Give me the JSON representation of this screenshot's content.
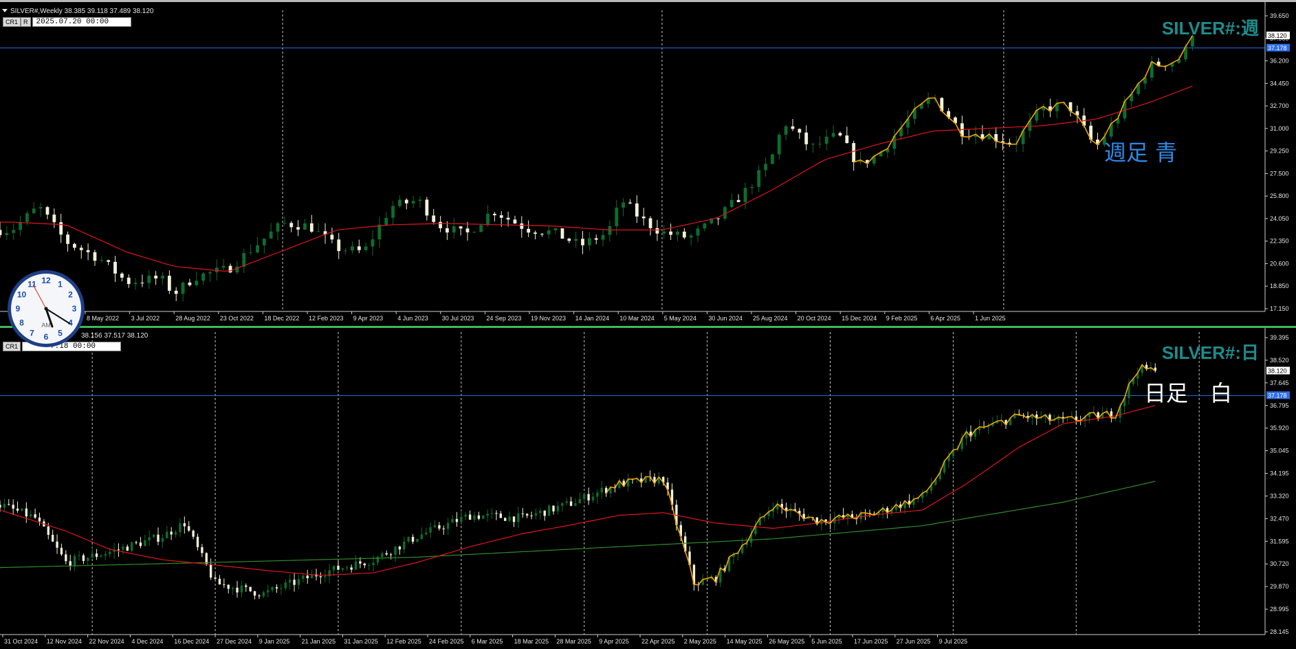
{
  "colors": {
    "background": "#000000",
    "grid": "#c8c8c8",
    "bull": "#0b6e2e",
    "bear": "#f2f2d8",
    "ma_red": "#e0161a",
    "ma_green": "#2f8c2a",
    "zigzag": "#f0a400",
    "hline": "#2e6fe6",
    "title": "#1d8c8c",
    "note_weekly": "#2f8ae6",
    "note_daily": "#ffffff"
  },
  "weekly": {
    "header": "SILVER#,Weekly  38.385 39.118 37.489 38.120",
    "btn1": "CR1",
    "btn2": "R",
    "datetime": "2025.07.20 00:00",
    "symbol_title": "SILVER#:週",
    "note": "週足 青",
    "price_labels": [
      "39.650",
      "37.900",
      "36.200",
      "34.450",
      "32.700",
      "31.000",
      "29.250",
      "27.500",
      "25.800",
      "24.050",
      "22.350",
      "20.600",
      "18.850",
      "17.150"
    ],
    "current_price": "38.120",
    "hline_price": "37.178",
    "date_labels": [
      "8 May 2022",
      "3 Jul 2022",
      "28 Aug 2022",
      "23 Oct 2022",
      "18 Dec 2022",
      "12 Feb 2023",
      "9 Apr 2023",
      "4 Jun 2023",
      "30 Jul 2023",
      "24 Sep 2023",
      "19 Nov 2023",
      "14 Jan 2024",
      "10 Mar 2024",
      "5 May 2024",
      "30 Jun 2024",
      "25 Aug 2024",
      "20 Oct 2024",
      "15 Dec 2024",
      "9 Feb 2025",
      "6 Apr 2025",
      "1 Jun 2025"
    ]
  },
  "daily": {
    "header": "38.156 37.517 38.120",
    "btn1": "CR1",
    "datetime": "7.18 00:00",
    "symbol_title": "SILVER#:日",
    "note": "日足　白",
    "price_labels": [
      "39.395",
      "38.520",
      "37.645",
      "36.795",
      "35.920",
      "35.045",
      "34.195",
      "33.320",
      "32.470",
      "31.595",
      "30.720",
      "29.870",
      "28.995",
      "28.145"
    ],
    "current_price": "38.120",
    "hline_price": "37.178",
    "date_labels": [
      "31 Oct 2024",
      "12 Nov 2024",
      "22 Nov 2024",
      "4 Dec 2024",
      "16 Dec 2024",
      "27 Dec 2024",
      "9 Jan 2025",
      "21 Jan 2025",
      "31 Jan 2025",
      "12 Feb 2025",
      "24 Feb 2025",
      "6 Mar 2025",
      "18 Mar 2025",
      "28 Mar 2025",
      "9 Apr 2025",
      "22 Apr 2025",
      "2 May 2025",
      "14 May 2025",
      "26 May 2025",
      "5 Jun 2025",
      "17 Jun 2025",
      "27 Jun 2025",
      "9 Jul 2025"
    ]
  },
  "clock": {
    "numbers": [
      "12",
      "1",
      "2",
      "3",
      "4",
      "5",
      "6",
      "7",
      "8",
      "9",
      "10",
      "11"
    ],
    "ampm": "AM"
  },
  "chart_data": [
    {
      "type": "candlestick",
      "title": "SILVER#:週",
      "timeframe": "Weekly",
      "ylim": [
        17.15,
        39.65
      ],
      "x_start": "2022-03",
      "x_end": "2025-07-20",
      "ohlc_last": {
        "open": 38.385,
        "high": 39.118,
        "low": 37.489,
        "close": 38.12
      },
      "horizontal_line": 37.178,
      "close_path": [
        [
          "2022-03-13",
          23.2
        ],
        [
          "2022-04-10",
          25.0
        ],
        [
          "2022-05-08",
          22.3
        ],
        [
          "2022-06-12",
          21.0
        ],
        [
          "2022-07-10",
          19.2
        ],
        [
          "2022-08-14",
          19.5
        ],
        [
          "2022-08-28",
          18.3
        ],
        [
          "2022-09-18",
          19.6
        ],
        [
          "2022-10-23",
          20.2
        ],
        [
          "2022-11-20",
          22.0
        ],
        [
          "2022-12-18",
          23.7
        ],
        [
          "2023-01-15",
          23.5
        ],
        [
          "2023-02-12",
          21.8
        ],
        [
          "2023-03-12",
          21.5
        ],
        [
          "2023-04-09",
          25.0
        ],
        [
          "2023-05-07",
          25.5
        ],
        [
          "2023-05-28",
          23.6
        ],
        [
          "2023-06-25",
          22.8
        ],
        [
          "2023-07-23",
          24.7
        ],
        [
          "2023-08-27",
          23.3
        ],
        [
          "2023-09-24",
          23.0
        ],
        [
          "2023-10-22",
          22.0
        ],
        [
          "2023-11-19",
          23.0
        ],
        [
          "2023-12-03",
          25.5
        ],
        [
          "2023-12-24",
          24.0
        ],
        [
          "2024-01-14",
          23.0
        ],
        [
          "2024-02-11",
          22.6
        ],
        [
          "2024-03-10",
          24.0
        ],
        [
          "2024-04-07",
          26.0
        ],
        [
          "2024-05-05",
          28.5
        ],
        [
          "2024-05-19",
          31.5
        ],
        [
          "2024-06-16",
          29.5
        ],
        [
          "2024-07-14",
          30.5
        ],
        [
          "2024-08-04",
          28.2
        ],
        [
          "2024-08-25",
          29.0
        ],
        [
          "2024-09-22",
          31.5
        ],
        [
          "2024-10-20",
          33.5
        ],
        [
          "2024-11-17",
          30.8
        ],
        [
          "2024-12-15",
          30.5
        ],
        [
          "2025-01-12",
          29.8
        ],
        [
          "2025-02-09",
          32.5
        ],
        [
          "2025-03-09",
          32.8
        ],
        [
          "2025-04-06",
          29.5
        ],
        [
          "2025-05-04",
          32.5
        ],
        [
          "2025-06-01",
          35.8
        ],
        [
          "2025-06-29",
          36.2
        ],
        [
          "2025-07-20",
          38.12
        ]
      ],
      "ma_red": [
        [
          "2022-03-13",
          23.8
        ],
        [
          "2022-05-08",
          23.6
        ],
        [
          "2022-07-10",
          21.5
        ],
        [
          "2022-08-28",
          20.4
        ],
        [
          "2022-10-23",
          20.0
        ],
        [
          "2022-12-18",
          21.6
        ],
        [
          "2023-02-12",
          23.2
        ],
        [
          "2023-04-09",
          23.6
        ],
        [
          "2023-06-04",
          23.7
        ],
        [
          "2023-07-30",
          23.6
        ],
        [
          "2023-09-24",
          23.5
        ],
        [
          "2023-11-19",
          23.2
        ],
        [
          "2024-01-14",
          23.2
        ],
        [
          "2024-03-10",
          24.1
        ],
        [
          "2024-05-05",
          26.2
        ],
        [
          "2024-06-30",
          28.6
        ],
        [
          "2024-08-25",
          29.8
        ],
        [
          "2024-10-20",
          30.8
        ],
        [
          "2024-12-15",
          31.0
        ],
        [
          "2025-02-09",
          31.2
        ],
        [
          "2025-04-06",
          31.7
        ],
        [
          "2025-06-01",
          33.0
        ],
        [
          "2025-07-20",
          34.4
        ]
      ]
    },
    {
      "type": "candlestick",
      "title": "SILVER#:日",
      "timeframe": "Daily",
      "ylim": [
        28.145,
        39.395
      ],
      "x_start": "2024-10-28",
      "x_end": "2025-07-18",
      "ohlc_last": {
        "high": 38.156,
        "low": 37.517,
        "close": 38.12
      },
      "horizontal_line": 37.178,
      "close_path": [
        [
          "2024-10-28",
          33.0
        ],
        [
          "2024-11-05",
          32.5
        ],
        [
          "2024-11-12",
          30.8
        ],
        [
          "2024-11-22",
          31.2
        ],
        [
          "2024-12-04",
          31.8
        ],
        [
          "2024-12-09",
          32.3
        ],
        [
          "2024-12-16",
          30.0
        ],
        [
          "2024-12-27",
          29.6
        ],
        [
          "2025-01-09",
          30.4
        ],
        [
          "2025-01-21",
          30.9
        ],
        [
          "2025-01-31",
          31.8
        ],
        [
          "2025-02-12",
          32.6
        ],
        [
          "2025-02-24",
          32.5
        ],
        [
          "2025-03-06",
          33.0
        ],
        [
          "2025-03-18",
          33.8
        ],
        [
          "2025-03-28",
          34.0
        ],
        [
          "2025-04-04",
          30.0
        ],
        [
          "2025-04-09",
          30.2
        ],
        [
          "2025-04-22",
          33.0
        ],
        [
          "2025-05-02",
          32.4
        ],
        [
          "2025-05-14",
          32.6
        ],
        [
          "2025-05-26",
          33.3
        ],
        [
          "2025-06-05",
          35.7
        ],
        [
          "2025-06-17",
          36.4
        ],
        [
          "2025-06-27",
          36.2
        ],
        [
          "2025-07-09",
          36.5
        ],
        [
          "2025-07-14",
          38.2
        ],
        [
          "2025-07-18",
          38.12
        ]
      ],
      "ma_red": [
        [
          "2024-10-28",
          32.8
        ],
        [
          "2024-11-12",
          32.0
        ],
        [
          "2024-11-22",
          31.3
        ],
        [
          "2024-12-04",
          30.9
        ],
        [
          "2024-12-16",
          30.7
        ],
        [
          "2024-12-27",
          30.5
        ],
        [
          "2025-01-09",
          30.3
        ],
        [
          "2025-01-21",
          30.4
        ],
        [
          "2025-01-31",
          30.8
        ],
        [
          "2025-02-12",
          31.4
        ],
        [
          "2025-02-24",
          31.9
        ],
        [
          "2025-03-06",
          32.2
        ],
        [
          "2025-03-18",
          32.6
        ],
        [
          "2025-03-28",
          32.7
        ],
        [
          "2025-04-09",
          32.3
        ],
        [
          "2025-04-22",
          32.1
        ],
        [
          "2025-05-02",
          32.3
        ],
        [
          "2025-05-14",
          32.6
        ],
        [
          "2025-05-26",
          32.8
        ],
        [
          "2025-06-05",
          33.8
        ],
        [
          "2025-06-17",
          35.2
        ],
        [
          "2025-06-27",
          36.1
        ],
        [
          "2025-07-09",
          36.4
        ],
        [
          "2025-07-18",
          36.8
        ]
      ],
      "ma_green": [
        [
          "2024-10-28",
          30.6
        ],
        [
          "2024-12-16",
          30.8
        ],
        [
          "2025-01-31",
          31.0
        ],
        [
          "2025-03-18",
          31.4
        ],
        [
          "2025-04-22",
          31.7
        ],
        [
          "2025-05-26",
          32.2
        ],
        [
          "2025-06-27",
          33.1
        ],
        [
          "2025-07-18",
          33.9
        ]
      ]
    }
  ]
}
